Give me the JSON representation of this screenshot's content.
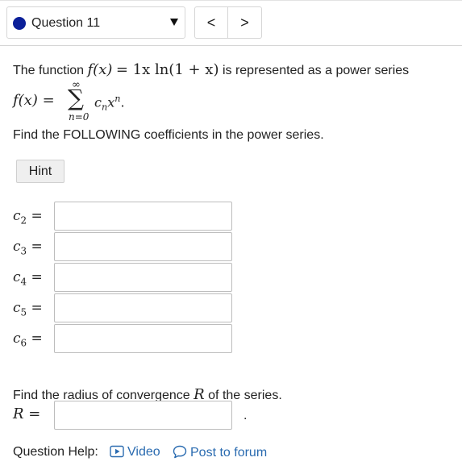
{
  "header": {
    "question_label": "Question 11",
    "prev_label": "<",
    "next_label": ">"
  },
  "problem": {
    "intro_prefix": "The function",
    "intro_suffix": "is represented as a power series",
    "function_lhs": "f(x)",
    "function_rhs": "= 1x ln(1 + x)",
    "sum_lhs": "f(x) =",
    "sum_upper": "∞",
    "sum_lower": "n=0",
    "sum_term_base": "c",
    "sum_term_sub": "n",
    "sum_term_var": "x",
    "sum_term_sup": "n",
    "sum_term_end": ".",
    "find_text": "Find the FOLLOWING coefficients in the power series."
  },
  "hint": {
    "label": "Hint"
  },
  "coefficients": [
    {
      "var": "c",
      "sub": "2",
      "eq": "=",
      "value": ""
    },
    {
      "var": "c",
      "sub": "3",
      "eq": "=",
      "value": ""
    },
    {
      "var": "c",
      "sub": "4",
      "eq": "=",
      "value": ""
    },
    {
      "var": "c",
      "sub": "5",
      "eq": "=",
      "value": ""
    },
    {
      "var": "c",
      "sub": "6",
      "eq": "=",
      "value": ""
    }
  ],
  "radius": {
    "text_prefix": "Find the radius of convergence",
    "text_var": "R",
    "text_suffix": "of the series.",
    "label_var": "R",
    "label_eq": "=",
    "value": "",
    "trailing": "."
  },
  "help": {
    "label": "Question Help:",
    "video_label": "Video",
    "forum_label": "Post to forum"
  },
  "colors": {
    "question_dot": "#0b1f99",
    "link": "#2a6bb0",
    "hint_bg": "#efefef"
  },
  "icons": {
    "question_status": "filled-circle-icon",
    "dropdown": "caret-down-icon",
    "video": "play-icon",
    "forum": "speech-bubble-icon"
  }
}
